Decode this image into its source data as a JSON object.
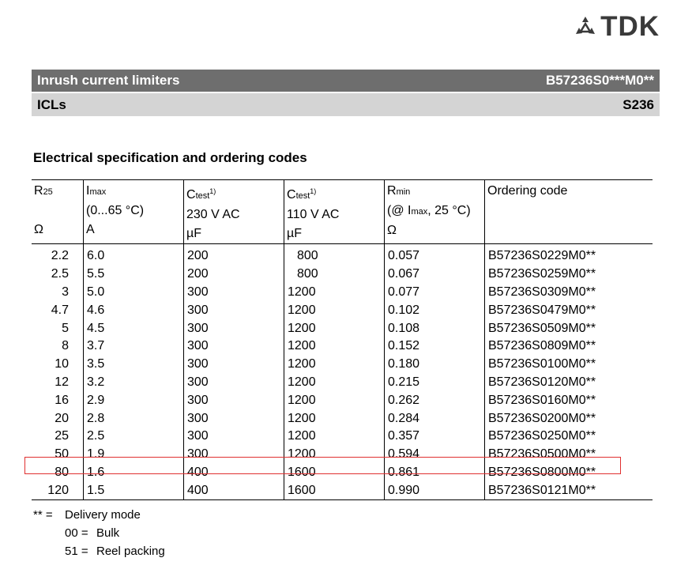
{
  "brand": "TDK",
  "header": {
    "title": "Inrush current limiters",
    "part": "B57236S0***M0**",
    "subtitle": "ICLs",
    "series": "S236"
  },
  "section_title": "Electrical specification and ordering codes",
  "columns": [
    {
      "sym": "R",
      "sub": "25",
      "sup": "",
      "line2": "",
      "unit": "Ω"
    },
    {
      "sym": "I",
      "sub": "max",
      "sup": "",
      "line2": "(0...65 °C)",
      "unit": "A"
    },
    {
      "sym": "C",
      "sub": "test",
      "sup": "1)",
      "line2": "230 V AC",
      "unit": "µF"
    },
    {
      "sym": "C",
      "sub": "test",
      "sup": "1)",
      "line2": "110 V AC",
      "unit": "µF"
    },
    {
      "sym": "R",
      "sub": "min",
      "sup": "",
      "line2_pre": "(@ I",
      "line2_sub": "max",
      "line2_post": ", 25 °C)",
      "unit": "Ω"
    },
    {
      "label": "Ordering code"
    }
  ],
  "rows": [
    [
      "2.2",
      "6.0",
      "200",
      "800",
      "0.057",
      "B57236S0229M0**"
    ],
    [
      "2.5",
      "5.5",
      "200",
      "800",
      "0.067",
      "B57236S0259M0**"
    ],
    [
      "3",
      "5.0",
      "300",
      "1200",
      "0.077",
      "B57236S0309M0**"
    ],
    [
      "4.7",
      "4.6",
      "300",
      "1200",
      "0.102",
      "B57236S0479M0**"
    ],
    [
      "5",
      "4.5",
      "300",
      "1200",
      "0.108",
      "B57236S0509M0**"
    ],
    [
      "8",
      "3.7",
      "300",
      "1200",
      "0.152",
      "B57236S0809M0**"
    ],
    [
      "10",
      "3.5",
      "300",
      "1200",
      "0.180",
      "B57236S0100M0**"
    ],
    [
      "12",
      "3.2",
      "300",
      "1200",
      "0.215",
      "B57236S0120M0**"
    ],
    [
      "16",
      "2.9",
      "300",
      "1200",
      "0.262",
      "B57236S0160M0**"
    ],
    [
      "20",
      "2.8",
      "300",
      "1200",
      "0.284",
      "B57236S0200M0**"
    ],
    [
      "25",
      "2.5",
      "300",
      "1200",
      "0.357",
      "B57236S0250M0**"
    ],
    [
      "50",
      "1.9",
      "300",
      "1200",
      "0.594",
      "B57236S0500M0**"
    ],
    [
      "80",
      "1.6",
      "400",
      "1600",
      "0.861",
      "B57236S0800M0**"
    ],
    [
      "120",
      "1.5",
      "400",
      "1600",
      "0.990",
      "B57236S0121M0**"
    ]
  ],
  "highlight_color": "#e03030",
  "notes": {
    "key": "** =",
    "label": "Delivery mode",
    "items": [
      {
        "code": "00 =",
        "desc": "Bulk"
      },
      {
        "code": "51 =",
        "desc": "Reel packing"
      }
    ]
  }
}
